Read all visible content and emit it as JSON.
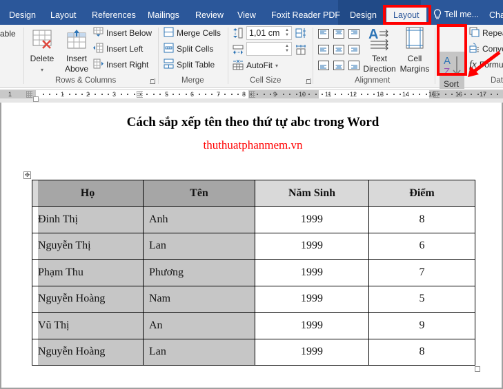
{
  "ribbon_tabs": [
    {
      "label": "Design",
      "active": false
    },
    {
      "label": "Layout",
      "active": false
    },
    {
      "label": "References",
      "active": false
    },
    {
      "label": "Mailings",
      "active": false
    },
    {
      "label": "Review",
      "active": false
    },
    {
      "label": "View",
      "active": false
    },
    {
      "label": "Foxit Reader PDF",
      "active": false
    },
    {
      "label": "Design",
      "active": false
    },
    {
      "label": "Layout",
      "active": true
    }
  ],
  "tell_me": "Tell me...",
  "tab_overflow": "Cha",
  "ribbon": {
    "partial_left_label": "able",
    "rows_columns": {
      "label": "Rows & Columns",
      "delete": "Delete",
      "insert_above_line1": "Insert",
      "insert_above_line2": "Above",
      "insert_below": "Insert Below",
      "insert_left": "Insert Left",
      "insert_right": "Insert Right"
    },
    "merge": {
      "label": "Merge",
      "merge_cells": "Merge Cells",
      "split_cells": "Split Cells",
      "split_table": "Split Table"
    },
    "cell_size": {
      "label": "Cell Size",
      "height_value": "1,01 cm",
      "width_value": "",
      "autofit": "AutoFit"
    },
    "alignment": {
      "label": "Alignment",
      "text_direction_line1": "Text",
      "text_direction_line2": "Direction",
      "cell_margins_line1": "Cell",
      "cell_margins_line2": "Margins"
    },
    "data": {
      "label": "Dat",
      "sort": "Sort",
      "repeat": "Repea",
      "convert": "Conve",
      "formula": "Formu"
    }
  },
  "ruler": {
    "left_numbers": [
      "1"
    ],
    "numbers": [
      "1",
      "2",
      "3",
      "5",
      "6",
      "7",
      "8",
      "9",
      "10",
      "11",
      "12",
      "13",
      "14",
      "15",
      "16",
      "17"
    ]
  },
  "document": {
    "title": "Cách sắp xếp tên theo thứ tự abc trong Word",
    "subtitle": "thuthuatphanmem.vn",
    "subtitle_color": "#ff0000",
    "table": {
      "headers": [
        "Họ",
        "Tên",
        "Năm Sinh",
        "Điểm"
      ],
      "rows": [
        [
          "Đinh Thị",
          "Anh",
          "1999",
          "8"
        ],
        [
          "Nguyễn Thị",
          "Lan",
          "1999",
          "6"
        ],
        [
          "Phạm Thu",
          "Phương",
          "1999",
          "7"
        ],
        [
          "Nguyễn Hoàng",
          "Nam",
          "1999",
          "5"
        ],
        [
          "Vũ Thị",
          "An",
          "1999",
          "9"
        ],
        [
          "Nguyễn Hoàng",
          "Lan",
          "1999",
          "8"
        ]
      ]
    }
  },
  "colors": {
    "tabbar": "#2b579a",
    "highlight": "#ff0000",
    "selected_cell": "#c6c6c6",
    "selected_header": "#a6a6a6"
  }
}
